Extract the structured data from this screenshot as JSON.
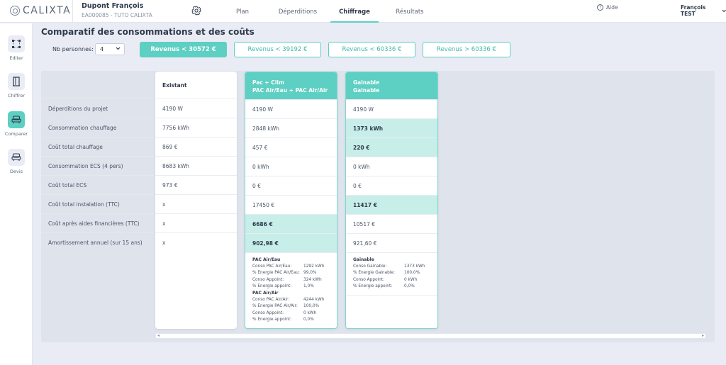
{
  "header": {
    "logo": "CALIXTA",
    "project_name": "Dupont François",
    "project_code": "EA000085 - TUTO CALIXTA",
    "tabs": [
      {
        "label": "Plan"
      },
      {
        "label": "Déperditions"
      },
      {
        "label": "Chiffrage"
      },
      {
        "label": "Résultats"
      }
    ],
    "active_tab": "Chiffrage",
    "help": "Aide",
    "user": "François TEST"
  },
  "sidebar": {
    "items": [
      {
        "label": "Editer",
        "icon": "nodes-icon"
      },
      {
        "label": "Chiffrer",
        "icon": "door-icon"
      },
      {
        "label": "Comparer",
        "icon": "sofa-icon",
        "active": true
      },
      {
        "label": "Devis",
        "icon": "sofa-icon"
      }
    ]
  },
  "main": {
    "title": "Comparatif des consommations et des coûts",
    "nb_personnes_label": "Nb personnes:",
    "nb_personnes_value": "4",
    "revenus": [
      {
        "label": "Revenus < 30572 €",
        "active": true
      },
      {
        "label": "Revenus < 39192 €"
      },
      {
        "label": "Revenus < 60336 €"
      },
      {
        "label": "Revenus > 60336 €"
      }
    ],
    "row_labels": [
      "Déperditions du projet",
      "Consommation chauffage",
      "Coût total chauffage",
      "Consommation ECS (4 pers)",
      "Coût total ECS",
      "Coût total instalation (TTC)",
      "Coût après aides financières (TTC)",
      "Amortissement annuel (sur 15 ans)"
    ],
    "columns": [
      {
        "header": [
          "Existant"
        ],
        "values": [
          "4190 W",
          "7756 kWh",
          "869 €",
          "8683 kWh",
          "973 €",
          "x",
          "x",
          "x"
        ]
      },
      {
        "header": [
          "Pac + Clim",
          "PAC Air/Eau + PAC Air/Air"
        ],
        "values": [
          "4190 W",
          "2848 kWh",
          "457 €",
          "0 kWh",
          "0 €",
          "17450 €",
          "6686 €",
          "902,98 €"
        ],
        "details": [
          {
            "title": "PAC Air/Eau",
            "lines": [
              [
                "Conso PAC Air/Eau:",
                "1292 kWh"
              ],
              [
                "% Energie PAC Air/Eau:",
                "99,0%"
              ],
              [
                "Conso Appoint:",
                "324 kWh"
              ],
              [
                "% Energie appoint:",
                "1,0%"
              ]
            ]
          },
          {
            "title": "PAC Air/Air",
            "lines": [
              [
                "Conso PAC Air/Air:",
                "4244 kWh"
              ],
              [
                "% Energie PAC Air/Air:",
                "100,0%"
              ],
              [
                "Conso Appoint:",
                "0 kWh"
              ],
              [
                "% Energie appoint:",
                "0,0%"
              ]
            ]
          }
        ]
      },
      {
        "header": [
          "Gainable",
          "Gainable"
        ],
        "values": [
          "4190 W",
          "1373 kWh",
          "220 €",
          "0 kWh",
          "0 €",
          "11417 €",
          "10517 €",
          "921,60 €"
        ],
        "details": [
          {
            "title": "Gainable",
            "lines": [
              [
                "Conso Gainable:",
                "1373 kWh"
              ],
              [
                "% Energie Gainable:",
                "100,0%"
              ],
              [
                "Conso Appoint:",
                "0 kWh"
              ],
              [
                "% Energie appoint:",
                "0,0%"
              ]
            ]
          }
        ]
      }
    ]
  },
  "colors": {
    "accent": "#5dcfc3",
    "highlight_cell": "#c8eee9",
    "background": "#e9ecf5"
  }
}
